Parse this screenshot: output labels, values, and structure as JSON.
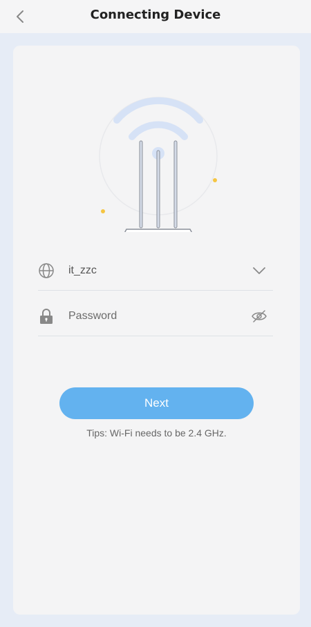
{
  "header": {
    "title": "Connecting Device",
    "back_icon": "chevron-left-icon"
  },
  "illustration": {
    "name": "router-wifi-illustration",
    "accent_color": "#f5c542",
    "wave_color": "#d6e2f6"
  },
  "form": {
    "ssid": {
      "icon": "globe-icon",
      "value": "it_zzc",
      "trailing_icon": "chevron-down-icon"
    },
    "password": {
      "icon": "lock-icon",
      "placeholder": "Password",
      "value": "",
      "trailing_icon": "eye-slash-icon"
    }
  },
  "actions": {
    "next_label": "Next",
    "button_color": "#63b2ef"
  },
  "tips": "Tips: Wi-Fi needs to be 2.4 GHz."
}
